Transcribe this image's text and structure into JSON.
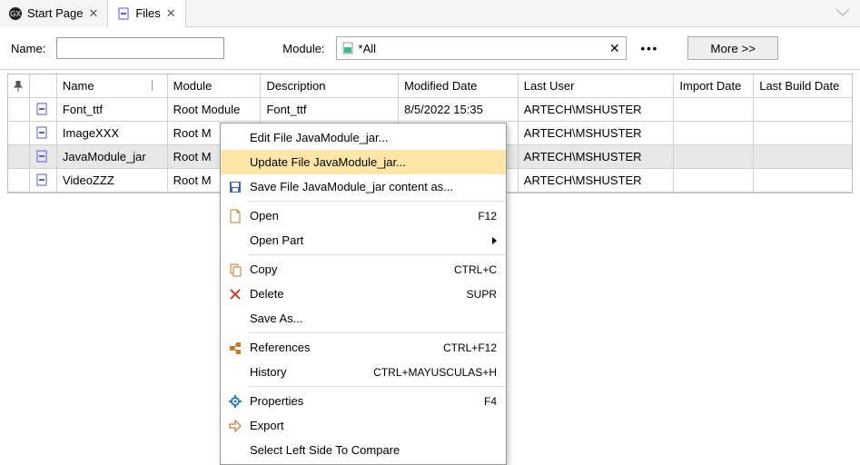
{
  "tabs": {
    "start": "Start Page",
    "files": "Files"
  },
  "filter": {
    "name_label": "Name:",
    "module_label": "Module:",
    "module_value": "*All",
    "more_label": "More >>"
  },
  "grid": {
    "headers": {
      "name": "Name",
      "module": "Module",
      "desc": "Description",
      "mdate": "Modified Date",
      "user": "Last User",
      "idate": "Import Date",
      "bdate": "Last Build Date"
    },
    "rows": [
      {
        "name": "Font_ttf",
        "module": "Root Module",
        "desc": "Font_ttf",
        "mdate": "8/5/2022 15:35",
        "user": "ARTECH\\MSHUSTER"
      },
      {
        "name": "ImageXXX",
        "module": "Root M",
        "desc": "",
        "mdate": "",
        "user": "ARTECH\\MSHUSTER"
      },
      {
        "name": "JavaModule_jar",
        "module": "Root M",
        "desc": "",
        "mdate": "",
        "user": "ARTECH\\MSHUSTER"
      },
      {
        "name": "VideoZZZ",
        "module": "Root M",
        "desc": "",
        "mdate": "",
        "user": "ARTECH\\MSHUSTER"
      }
    ]
  },
  "menu": {
    "edit": "Edit File JavaModule_jar...",
    "update": "Update File JavaModule_jar...",
    "saveContent": "Save File JavaModule_jar content as...",
    "open": "Open",
    "openPart": "Open Part",
    "copy": "Copy",
    "delete": "Delete",
    "saveAs": "Save As...",
    "references": "References",
    "history": "History",
    "properties": "Properties",
    "export": "Export",
    "compare": "Select Left Side To Compare",
    "sc_open": "F12",
    "sc_copy": "CTRL+C",
    "sc_delete": "SUPR",
    "sc_refs": "CTRL+F12",
    "sc_history": "CTRL+MAYUSCULAS+H",
    "sc_props": "F4"
  }
}
